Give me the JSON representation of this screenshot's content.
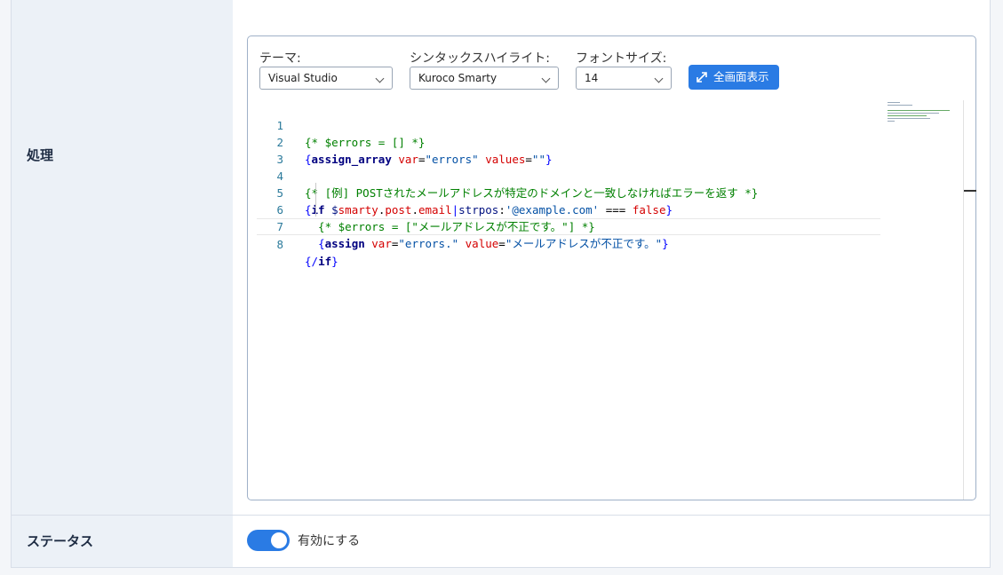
{
  "fields": {
    "processing_label": "処理",
    "status_label": "ステータス"
  },
  "toolbar": {
    "theme_label": "テーマ:",
    "theme_value": "Visual Studio",
    "syntax_label": "シンタックスハイライト:",
    "syntax_value": "Kuroco Smarty",
    "font_size_label": "フォントサイズ:",
    "font_size_value": "14",
    "fullscreen_label": "全画面表示"
  },
  "editor": {
    "line_numbers": [
      "1",
      "2",
      "3",
      "4",
      "5",
      "6",
      "7",
      "8"
    ],
    "lines": [
      "{* $errors = [] *}",
      "{assign_array var=\"errors\" values=\"\"}",
      "",
      "{* [例] POSTされたメールアドレスが特定のドメインと一致しなければエラーを返す *}",
      "{if $smarty.post.email|strpos:'@example.com' === false}",
      "  {* $errors = [\"メールアドレスが不正です。\"] *}",
      "  {assign var=\"errors.\" value=\"メールアドレスが不正です。\"}",
      "{/if}"
    ]
  },
  "status": {
    "enabled": true,
    "toggle_label": "有効にする"
  },
  "colors": {
    "accent": "#2a7be4",
    "label_bg": "#ecf1f7",
    "comment": "#008000",
    "keyword": "#000080",
    "attribute": "#d40000"
  }
}
